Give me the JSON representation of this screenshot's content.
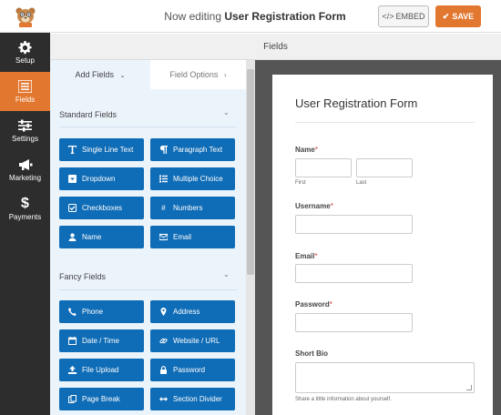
{
  "header": {
    "editing_prefix": "Now editing ",
    "form_name": "User Registration Form",
    "embed_label": "EMBED",
    "save_label": "SAVE"
  },
  "leftnav": {
    "items": [
      {
        "label": "Setup",
        "icon": "gear-icon"
      },
      {
        "label": "Fields",
        "icon": "list-icon"
      },
      {
        "label": "Settings",
        "icon": "sliders-icon"
      },
      {
        "label": "Marketing",
        "icon": "megaphone-icon"
      },
      {
        "label": "Payments",
        "icon": "dollar-icon"
      }
    ]
  },
  "fields_header": "Fields",
  "panel": {
    "tab_add": "Add Fields",
    "tab_options": "Field Options",
    "standard_title": "Standard Fields",
    "fancy_title": "Fancy Fields",
    "standard": [
      {
        "label": "Single Line Text",
        "icon": "text-cursor-icon"
      },
      {
        "label": "Paragraph Text",
        "icon": "paragraph-icon"
      },
      {
        "label": "Dropdown",
        "icon": "dropdown-icon"
      },
      {
        "label": "Multiple Choice",
        "icon": "list-icon"
      },
      {
        "label": "Checkboxes",
        "icon": "checkbox-icon"
      },
      {
        "label": "Numbers",
        "icon": "hash-icon"
      },
      {
        "label": "Name",
        "icon": "user-icon"
      },
      {
        "label": "Email",
        "icon": "envelope-icon"
      }
    ],
    "fancy": [
      {
        "label": "Phone",
        "icon": "phone-icon"
      },
      {
        "label": "Address",
        "icon": "map-pin-icon"
      },
      {
        "label": "Date / Time",
        "icon": "calendar-icon"
      },
      {
        "label": "Website / URL",
        "icon": "link-icon"
      },
      {
        "label": "File Upload",
        "icon": "upload-icon"
      },
      {
        "label": "Password",
        "icon": "lock-icon"
      },
      {
        "label": "Page Break",
        "icon": "copy-icon"
      },
      {
        "label": "Section Divider",
        "icon": "arrows-h-icon"
      }
    ]
  },
  "form": {
    "title": "User Registration Form",
    "name_label": "Name",
    "first_sublabel": "First",
    "last_sublabel": "Last",
    "username_label": "Username",
    "email_label": "Email",
    "password_label": "Password",
    "bio_label": "Short Bio",
    "bio_description": "Share a little information about yourself.",
    "required_marker": "*"
  },
  "colors": {
    "accent": "#e27730",
    "button_blue": "#0f6cb6",
    "nav_bg": "#2d2d2d",
    "panel_bg": "#ebf3fb"
  }
}
